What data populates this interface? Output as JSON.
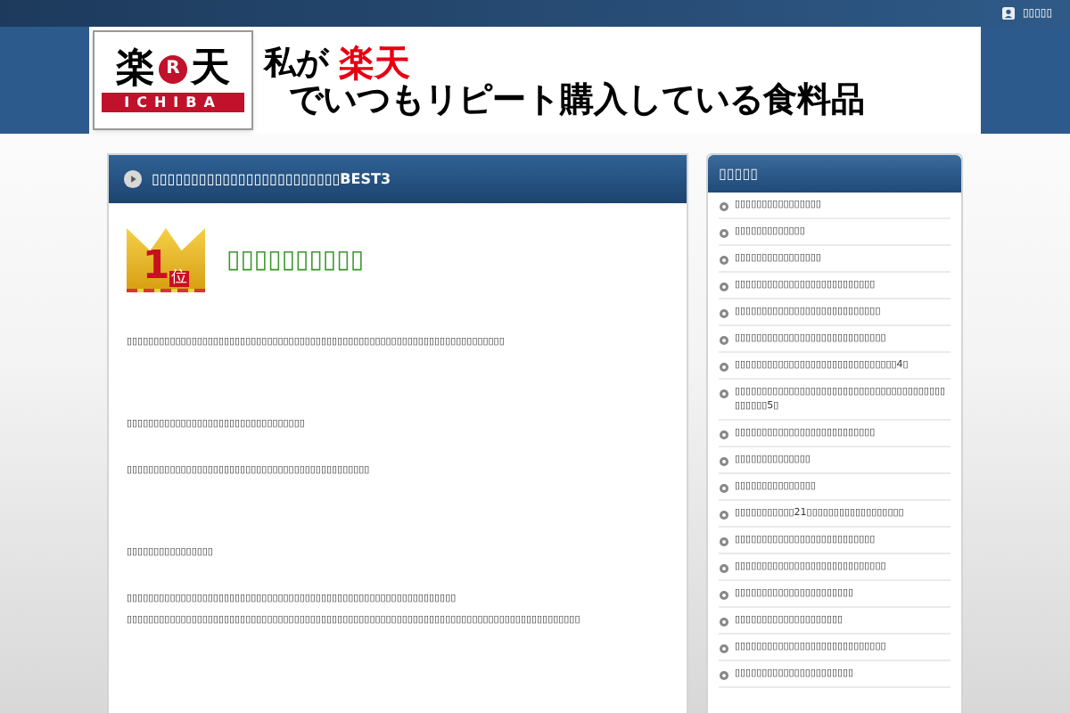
{
  "top_bar": {
    "link": "▯▯▯▯▯"
  },
  "banner": {
    "logo_top": [
      "楽",
      "R",
      "天"
    ],
    "logo_bottom": "ICHIBA",
    "tagline_1": "私が",
    "tagline_brand": "楽天",
    "tagline_2": "でいつもリピート購入している食料品"
  },
  "main": {
    "heading": "▯▯▯▯▯▯▯▯▯▯▯▯▯▯▯▯▯▯▯▯▯▯▯▯BEST3",
    "rank_badge": {
      "number": "1",
      "suffix": "位"
    },
    "title": "▯▯▯▯▯▯▯▯▯▯",
    "paragraphs": [
      {
        "lines": [
          "▯▯▯▯▯▯▯▯▯▯▯▯▯▯▯▯▯▯▯▯▯▯▯▯▯▯▯▯▯▯▯▯▯▯▯▯▯▯▯▯▯▯▯▯▯▯▯▯▯▯▯▯▯▯▯▯▯▯▯▯▯▯▯▯▯▯▯▯▯▯"
        ]
      },
      {
        "lines": [
          "▯▯▯▯▯▯▯▯▯▯▯▯▯▯▯▯▯▯**▯▯▯▯▯▯▯▯▯▯▯**▯▯▯▯"
        ]
      },
      {
        "lines": [
          "▯▯▯▯▯▯▯▯▯▯▯▯▯▯▯▯▯▯▯▯▯▯▯▯▯▯▯▯▯▯▯▯▯▯▯▯▯▯▯▯▯▯▯▯▯"
        ]
      },
      {
        "lines": [
          "▯▯▯▯▯▯▯▯▯▯▯▯▯▯▯▯"
        ]
      },
      {
        "lines": [
          "▯▯▯▯▯▯▯▯▯▯▯▯▯▯▯▯▯▯▯▯▯▯▯▯▯▯▯▯▯▯▯▯▯▯▯▯▯▯▯▯▯▯▯▯▯▯▯▯▯▯▯▯▯▯▯▯▯▯▯▯▯",
          "▯▯▯▯▯▯▯▯▯▯▯▯▯▯▯▯▯▯▯▯▯▯▯▯▯▯▯▯▯▯▯▯▯▯▯▯▯▯▯▯▯▯▯▯▯▯▯▯▯▯▯▯▯▯▯▯▯▯▯▯▯▯▯▯▯▯▯▯▯▯▯▯▯▯▯▯▯▯▯▯▯▯▯▯"
        ]
      }
    ]
  },
  "sidebar": {
    "heading": "▯▯▯▯▯",
    "items": [
      "▯▯▯▯▯▯▯▯▯▯▯▯▯▯▯▯",
      "▯▯▯▯▯▯▯▯▯▯▯▯▯",
      "▯▯▯▯▯▯▯▯▯▯▯▯▯▯▯▯",
      "▯▯▯▯▯▯▯▯▯▯▯▯▯▯▯▯▯▯▯▯▯▯▯▯▯▯",
      "▯▯▯▯▯▯▯▯▯▯▯▯▯▯▯▯▯▯▯▯▯▯▯▯▯▯▯",
      "▯▯▯▯▯▯▯▯▯▯▯▯▯▯▯▯▯▯▯▯▯▯▯▯▯▯▯▯",
      "▯▯▯▯▯▯▯▯▯▯▯▯▯▯▯▯▯▯▯▯▯▯▯▯▯▯▯▯▯▯4▯",
      "▯▯▯▯▯▯▯▯▯▯▯▯▯▯▯▯▯▯▯▯▯▯▯▯▯▯▯▯▯▯▯▯▯▯▯▯▯▯▯▯▯▯▯▯▯5▯",
      "▯▯▯▯▯▯▯▯▯▯▯▯▯▯▯▯▯▯▯▯▯▯▯▯▯▯",
      "▯▯▯▯▯▯▯▯▯▯▯▯▯▯",
      "▯▯▯▯▯▯▯▯▯▯▯▯▯▯▯",
      "▯▯▯▯▯▯▯▯▯▯▯21▯▯▯▯▯▯▯▯▯▯▯▯▯▯▯▯▯▯",
      "▯▯▯▯▯▯▯▯▯▯▯▯▯▯▯▯▯▯▯▯▯▯▯▯▯▯",
      "▯▯▯▯▯▯▯▯▯▯▯▯▯▯▯▯▯▯▯▯▯▯▯▯▯▯▯▯",
      "▯▯▯▯▯▯▯▯▯▯▯▯▯▯▯▯▯▯▯▯▯▯",
      "▯▯▯▯▯▯▯▯▯▯▯▯▯▯▯▯▯▯▯▯",
      "▯▯▯▯▯▯▯▯▯▯▯▯▯▯▯▯▯▯▯▯▯▯▯▯▯▯▯▯",
      "▯▯▯▯▯▯▯▯▯▯▯▯▯▯▯▯▯▯▯▯▯▯"
    ]
  }
}
